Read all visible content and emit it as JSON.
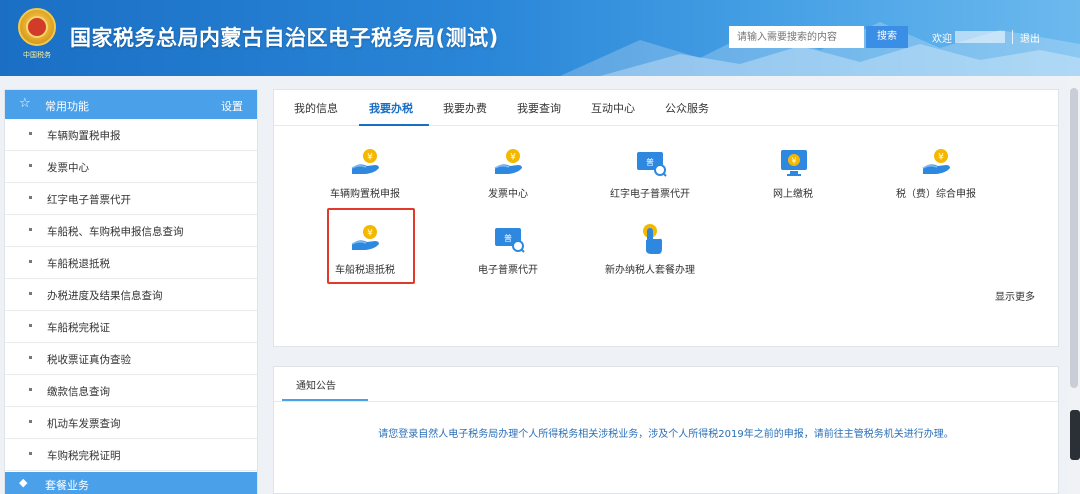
{
  "header": {
    "emblem_text": "中国税务",
    "title": "国家税务总局内蒙古自治区电子税务局(测试)",
    "search_placeholder": "请输入需要搜索的内容",
    "search_button": "搜索",
    "welcome": "欢迎",
    "logout": "退出"
  },
  "sidebar": {
    "header_label": "常用功能",
    "settings_label": "设置",
    "items": [
      {
        "label": "车辆购置税申报"
      },
      {
        "label": "发票中心"
      },
      {
        "label": "红字电子普票代开"
      },
      {
        "label": "车船税、车购税申报信息查询"
      },
      {
        "label": "车船税退抵税"
      },
      {
        "label": "办税进度及结果信息查询"
      },
      {
        "label": "车船税完税证"
      },
      {
        "label": "税收票证真伪查验"
      },
      {
        "label": "缴款信息查询"
      },
      {
        "label": "机动车发票查询"
      },
      {
        "label": "车购税完税证明"
      }
    ],
    "footer_label": "套餐业务"
  },
  "tabs": [
    {
      "label": "我的信息"
    },
    {
      "label": "我要办税"
    },
    {
      "label": "我要办费"
    },
    {
      "label": "我要查询"
    },
    {
      "label": "互动中心"
    },
    {
      "label": "公众服务"
    }
  ],
  "services": [
    {
      "label": "车辆购置税申报",
      "icon": "hand-coin-icon"
    },
    {
      "label": "发票中心",
      "icon": "hand-coin-icon"
    },
    {
      "label": "红字电子普票代开",
      "icon": "invoice-search-icon"
    },
    {
      "label": "网上缴税",
      "icon": "monitor-yen-icon"
    },
    {
      "label": "税（费）综合申报",
      "icon": "hand-coin-icon"
    },
    {
      "label": "车船税退抵税",
      "icon": "hand-coin-icon"
    },
    {
      "label": "电子普票代开",
      "icon": "invoice-search-icon"
    },
    {
      "label": "新办纳税人套餐办理",
      "icon": "touch-hand-icon"
    }
  ],
  "show_more": "显示更多",
  "notice": {
    "tab": "通知公告",
    "text": "请您登录自然人电子税务局办理个人所得税务相关涉税业务，涉及个人所得税2019年之前的申报，请前往主管税务机关进行办理。"
  },
  "colors": {
    "header": "#1a6fc4",
    "accent": "#4ba0ea",
    "highlight_border": "#e23a2a",
    "coin": "#f5b800"
  }
}
